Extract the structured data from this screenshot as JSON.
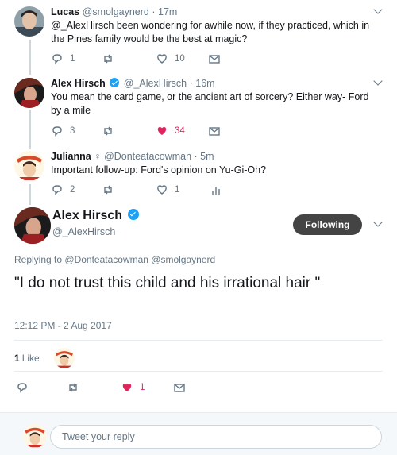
{
  "tweets": [
    {
      "name": "Lucas",
      "handle": "@smolgaynerd",
      "time": "17m",
      "text": "@_AlexHirsch been wondering for awhile now, if they practiced, which in the Pines family would be the best at magic?",
      "replies": "1",
      "retweets": "",
      "likes": "10"
    },
    {
      "name": "Alex Hirsch",
      "handle": "@_AlexHirsch",
      "time": "16m",
      "text": "You mean the card game, or the ancient art of sorcery? Either way- Ford by a mile",
      "replies": "3",
      "retweets": "",
      "likes": "34"
    },
    {
      "name": "Julianna",
      "name_glyph": "♀",
      "handle": "@Donteatacowman",
      "time": "5m",
      "text": "Important follow-up: Ford's opinion on Yu-Gi-Oh?",
      "replies": "2",
      "retweets": "",
      "likes": "1"
    }
  ],
  "main": {
    "name": "Alex Hirsch",
    "handle": "@_AlexHirsch",
    "follow_label": "Following",
    "replying_prefix": "Replying to",
    "replying_to": "@Donteatacowman @smolgaynerd",
    "text": "\"I do not trust this child and his irrational hair \"",
    "timestamp": "12:12 PM - 2 Aug 2017",
    "likes_count": "1",
    "likes_label": "Like",
    "action_likes": "1"
  },
  "reply_bar": {
    "placeholder": "Tweet your reply"
  },
  "colors": {
    "accent": "#1da1f2",
    "like": "#e0245e",
    "muted": "#657786",
    "follow_button": "#444444"
  },
  "icons": [
    "reply-icon",
    "retweet-icon",
    "heart-icon",
    "message-icon",
    "analytics-icon",
    "verified-icon",
    "chevron-down-icon"
  ]
}
